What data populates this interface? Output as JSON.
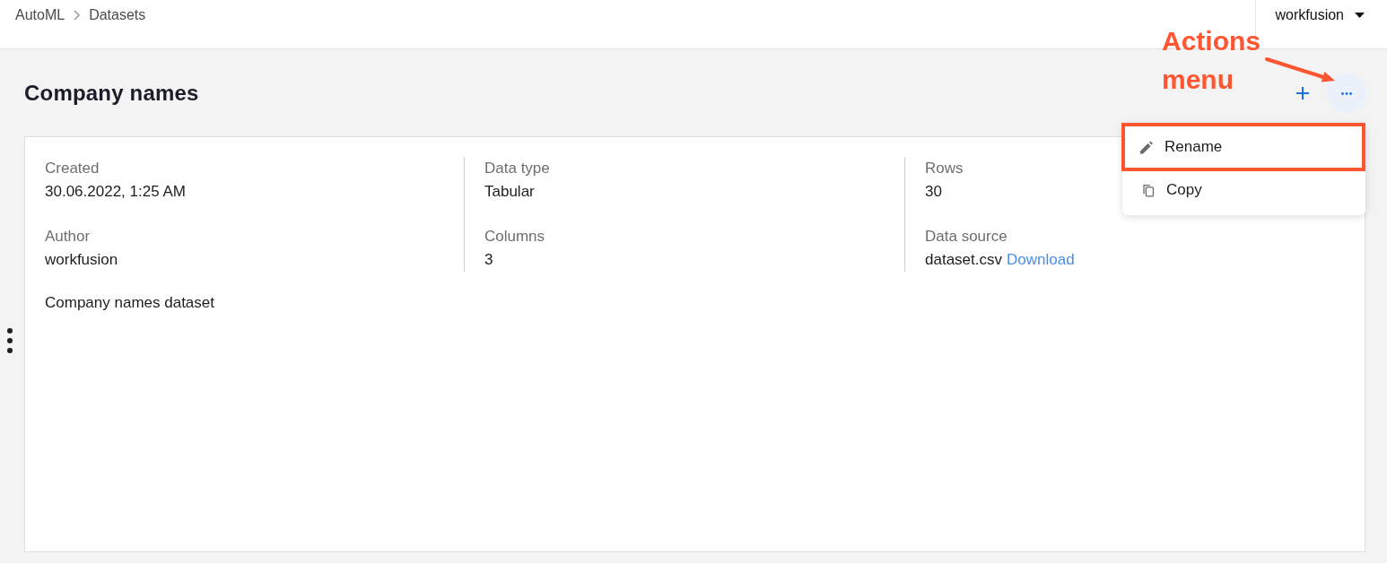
{
  "header": {
    "breadcrumb": [
      {
        "label": "AutoML"
      },
      {
        "label": "Datasets"
      }
    ],
    "user": "workfusion"
  },
  "title": "Company names",
  "actions_menu": {
    "open": true,
    "items": [
      {
        "label": "Rename",
        "kind": "edit",
        "highlighted": true
      },
      {
        "label": "Copy",
        "kind": "copy",
        "highlighted": false
      }
    ]
  },
  "annotation": {
    "text": "Actions menu"
  },
  "details": {
    "columns": [
      {
        "fields": [
          {
            "label": "Created",
            "value": "30.06.2022, 1:25 AM"
          },
          {
            "label": "Author",
            "value": "workfusion"
          }
        ]
      },
      {
        "fields": [
          {
            "label": "Data type",
            "value": "Tabular"
          },
          {
            "label": "Columns",
            "value": "3"
          }
        ]
      },
      {
        "fields": [
          {
            "label": "Rows",
            "value": "30"
          },
          {
            "label": "Data source",
            "value": "dataset.csv",
            "link": "Download"
          }
        ]
      }
    ],
    "description": "Company names dataset"
  }
}
